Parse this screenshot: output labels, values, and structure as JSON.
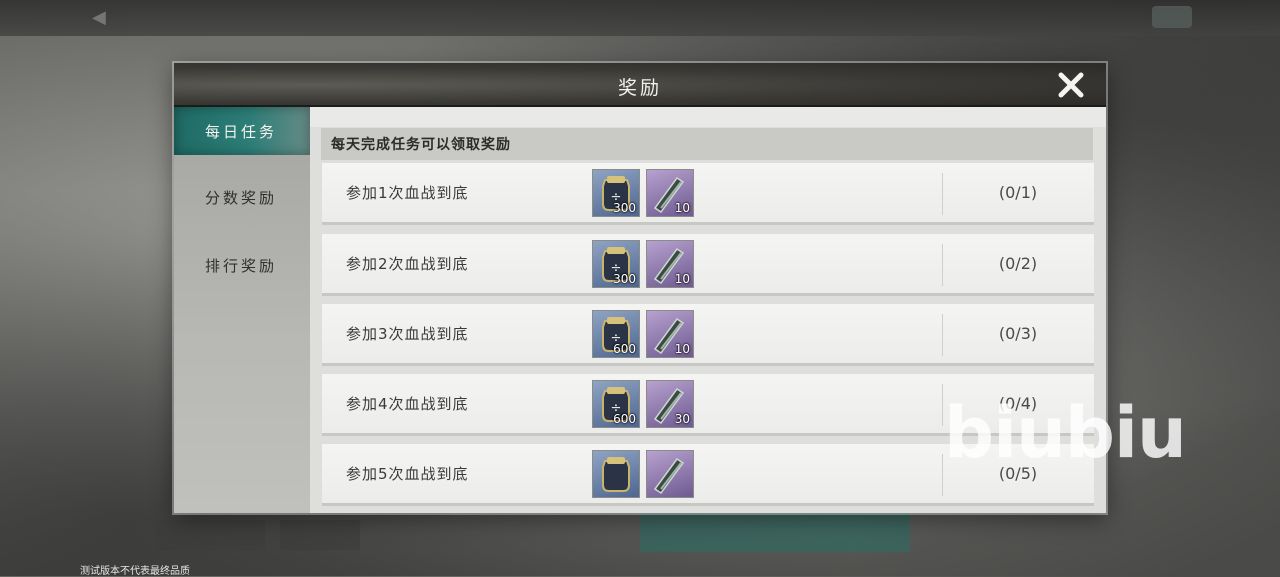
{
  "background": {
    "footer_note": "测试版本不代表最终品质",
    "watermark": "biubiu"
  },
  "dialog": {
    "title": "奖励",
    "close_icon": "close-icon"
  },
  "nav": {
    "items": [
      {
        "label": "每日任务",
        "active": true
      },
      {
        "label": "分数奖励",
        "active": false
      },
      {
        "label": "排行奖励",
        "active": false
      }
    ]
  },
  "content": {
    "info": "每天完成任务可以领取奖励",
    "tasks": [
      {
        "label": "参加1次血战到底",
        "rewards": [
          {
            "icon": "token-bag-icon",
            "qty": "300"
          },
          {
            "icon": "blade-scroll-icon",
            "qty": "10"
          }
        ],
        "progress": "(0/1)"
      },
      {
        "label": "参加2次血战到底",
        "rewards": [
          {
            "icon": "token-bag-icon",
            "qty": "300"
          },
          {
            "icon": "blade-scroll-icon",
            "qty": "10"
          }
        ],
        "progress": "(0/2)"
      },
      {
        "label": "参加3次血战到底",
        "rewards": [
          {
            "icon": "token-bag-icon",
            "qty": "600"
          },
          {
            "icon": "blade-scroll-icon",
            "qty": "10"
          }
        ],
        "progress": "(0/3)"
      },
      {
        "label": "参加4次血战到底",
        "rewards": [
          {
            "icon": "token-bag-icon",
            "qty": "600"
          },
          {
            "icon": "blade-scroll-icon",
            "qty": "30"
          }
        ],
        "progress": "(0/4)"
      },
      {
        "label": "参加5次血战到底",
        "rewards": [
          {
            "icon": "token-bag-icon",
            "qty": ""
          },
          {
            "icon": "blade-scroll-icon",
            "qty": ""
          }
        ],
        "progress": "(0/5)"
      }
    ]
  },
  "colors": {
    "active_tab": "#2c7e77",
    "header": "#3a3935"
  }
}
